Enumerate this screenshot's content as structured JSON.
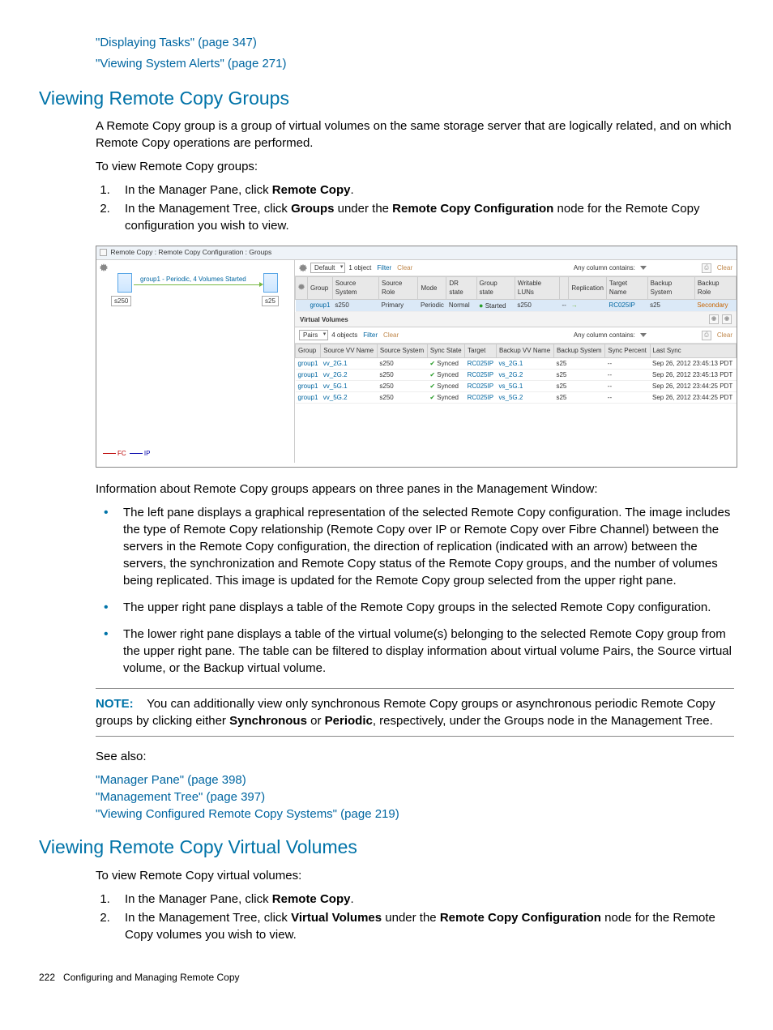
{
  "top_links": {
    "l1": "\"Displaying Tasks\" (page 347)",
    "l2": "\"Viewing System Alerts\" (page 271)"
  },
  "section1": {
    "heading": "Viewing Remote Copy Groups",
    "p1": "A Remote Copy group is a group of virtual volumes on the same storage server that are logically related, and on which Remote Copy operations are performed.",
    "p2": "To view Remote Copy groups:",
    "step1_a": "In the Manager Pane, click ",
    "step1_b": "Remote Copy",
    "step1_c": ".",
    "step2_a": "In the Management Tree, click ",
    "step2_b": "Groups",
    "step2_c": " under the ",
    "step2_d": "Remote Copy Configuration",
    "step2_e": " node for the Remote Copy configuration you wish to view.",
    "after": "Information about Remote Copy groups appears on three panes in the Management Window:",
    "b1": "The left pane displays a graphical representation of the selected Remote Copy configuration. The image includes the type of Remote Copy relationship (Remote Copy over IP or Remote Copy over Fibre Channel) between the servers in the Remote Copy configuration, the direction of replication (indicated with an arrow) between the servers, the synchronization and Remote Copy status of the Remote Copy groups, and the number of volumes being replicated. This image is updated for the Remote Copy group selected from the upper right pane.",
    "b2": "The upper right pane displays a table of the Remote Copy groups in the selected Remote Copy configuration.",
    "b3": "The lower right pane displays a table of the virtual volume(s) belonging to the selected Remote Copy group from the upper right pane. The table can be filtered to display information about virtual volume Pairs, the Source virtual volume, or the Backup virtual volume.",
    "note_label": "NOTE:",
    "note_a": "You can additionally view only synchronous Remote Copy groups or asynchronous periodic Remote Copy groups by clicking either ",
    "note_b": "Synchronous",
    "note_c": " or ",
    "note_d": "Periodic",
    "note_e": ", respectively, under the Groups node in the Management Tree.",
    "see_also": "See also:",
    "sa1": "\"Manager Pane\" (page 398)",
    "sa2": "\"Management Tree\" (page 397)",
    "sa3": "\"Viewing Configured Remote Copy Systems\" (page 219)"
  },
  "section2": {
    "heading": "Viewing Remote Copy Virtual Volumes",
    "p1": "To view Remote Copy virtual volumes:",
    "step1_a": "In the Manager Pane, click ",
    "step1_b": "Remote Copy",
    "step1_c": ".",
    "step2_a": "In the Management Tree, click ",
    "step2_b": "Virtual Volumes",
    "step2_c": " under the ",
    "step2_d": "Remote Copy Configuration",
    "step2_e": " node for the Remote Copy volumes you wish to view."
  },
  "footer": {
    "page": "222",
    "chapter": "Configuring and Managing Remote Copy"
  },
  "figure": {
    "title": "Remote Copy : Remote Copy Configuration : Groups",
    "left": {
      "diag_label": "group1 - Periodic, 4 Volumes Started",
      "s1": "s250",
      "s2": "s25",
      "fc": "FC",
      "ip": "IP"
    },
    "toolbar1": {
      "dd": "Default",
      "count": "1 object",
      "filter": "Filter",
      "clear": "Clear",
      "anycol": "Any column contains:",
      "clear2": "Clear"
    },
    "table1": {
      "h": [
        "Group",
        "Source System",
        "Source Role",
        "Mode",
        "DR state",
        "Group state",
        "Writable LUNs",
        "Replication",
        "Target Name",
        "Backup System",
        "Backup Role"
      ],
      "r": [
        "group1",
        "s250",
        "Primary",
        "Periodic",
        "Normal",
        "Started",
        "s250",
        "--",
        "→",
        "RC025IP",
        "s25",
        "Secondary"
      ]
    },
    "sectionLabel": "Virtual Volumes",
    "toolbar2": {
      "dd": "Pairs",
      "count": "4 objects",
      "filter": "Filter",
      "clear": "Clear",
      "anycol": "Any column contains:",
      "clear2": "Clear"
    },
    "table2": {
      "h": [
        "Group",
        "Source VV Name",
        "Source System",
        "Sync State",
        "Target",
        "Backup VV Name",
        "Backup System",
        "Sync Percent",
        "Last Sync"
      ],
      "rows": [
        [
          "group1",
          "vv_2G.1",
          "s250",
          "Synced",
          "RC025IP",
          "vs_2G.1",
          "s25",
          "--",
          "Sep 26, 2012 23:45:13 PDT"
        ],
        [
          "group1",
          "vv_2G.2",
          "s250",
          "Synced",
          "RC025IP",
          "vs_2G.2",
          "s25",
          "--",
          "Sep 26, 2012 23:45:13 PDT"
        ],
        [
          "group1",
          "vv_5G.1",
          "s250",
          "Synced",
          "RC025IP",
          "vs_5G.1",
          "s25",
          "--",
          "Sep 26, 2012 23:44:25 PDT"
        ],
        [
          "group1",
          "vv_5G.2",
          "s250",
          "Synced",
          "RC025IP",
          "vs_5G.2",
          "s25",
          "--",
          "Sep 26, 2012 23:44:25 PDT"
        ]
      ]
    }
  }
}
